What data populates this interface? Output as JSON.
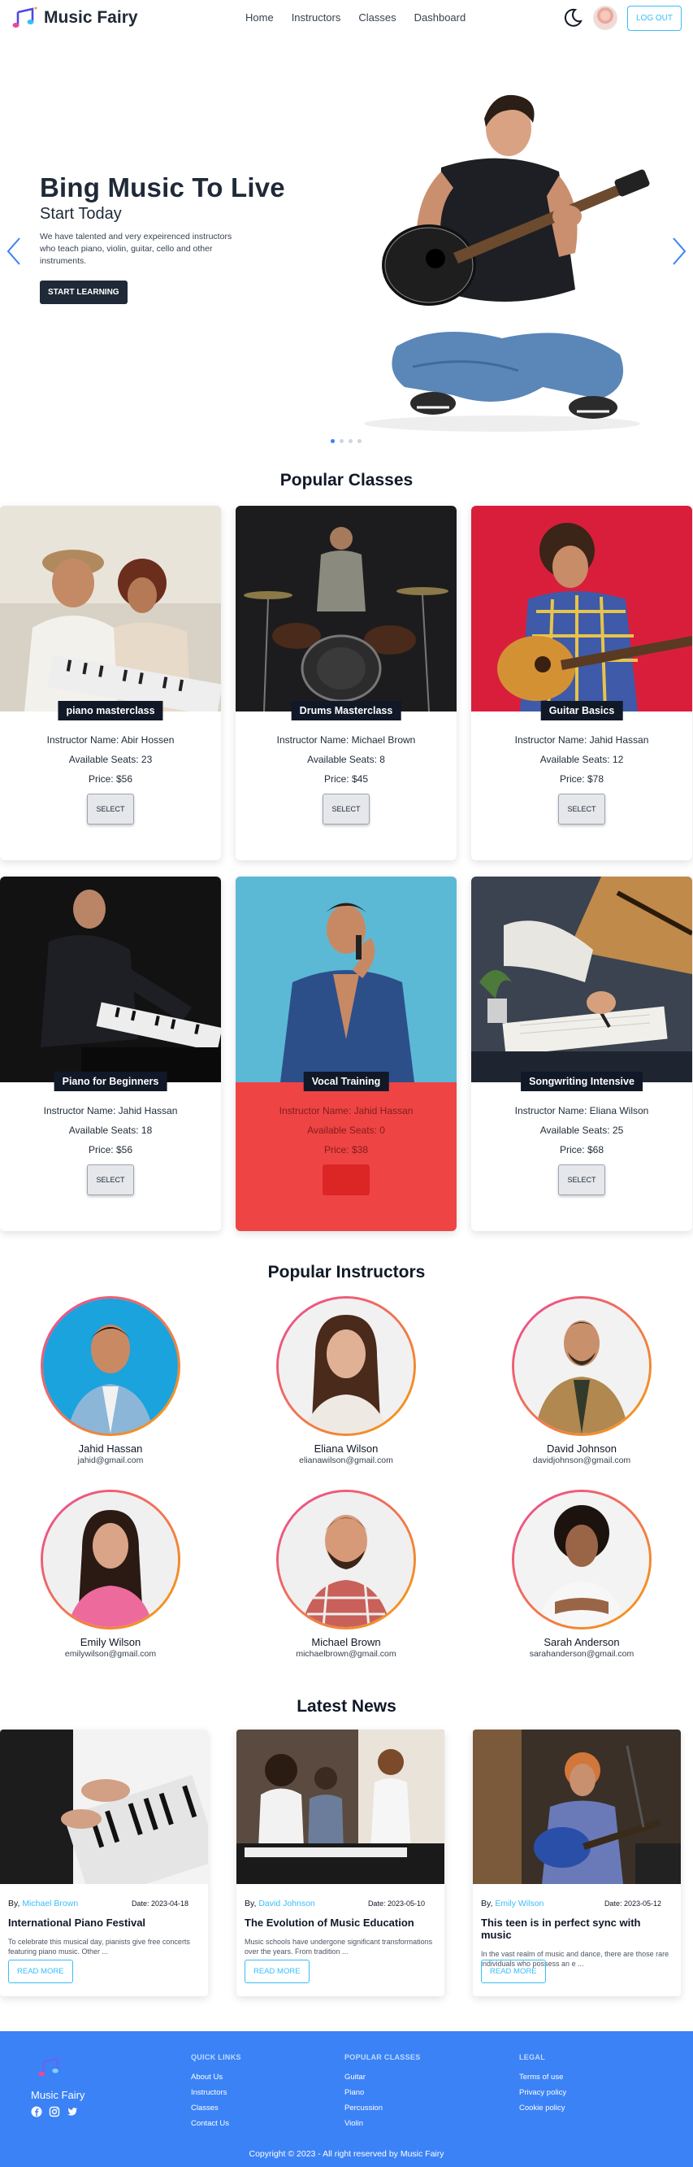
{
  "navbar": {
    "brand": "Music Fairy",
    "links": [
      "Home",
      "Instructors",
      "Classes",
      "Dashboard"
    ],
    "logout": "LOG OUT"
  },
  "hero": {
    "title": "Bing Music To Live",
    "subtitle": "Start Today",
    "description": "We have talented and very expeirenced instructors who teach piano, violin, guitar, cello and other instruments.",
    "button": "START LEARNING",
    "slide_count": 4,
    "active_slide": 1
  },
  "classes": {
    "title": "Popular Classes",
    "instructor_prefix": "Instructor Name: ",
    "seats_prefix": "Available Seats: ",
    "price_prefix": "Price: $",
    "select_label": "SELECT",
    "items": [
      {
        "name": "piano masterclass",
        "instructor": "Abir Hossen",
        "seats": "23",
        "price": "56",
        "sold_out": false
      },
      {
        "name": "Drums Masterclass",
        "instructor": "Michael Brown",
        "seats": "8",
        "price": "45",
        "sold_out": false
      },
      {
        "name": "Guitar Basics",
        "instructor": "Jahid Hassan",
        "seats": "12",
        "price": "78",
        "sold_out": false
      },
      {
        "name": "Piano for Beginners",
        "instructor": "Jahid Hassan",
        "seats": "18",
        "price": "56",
        "sold_out": false
      },
      {
        "name": "Vocal Training",
        "instructor": "Jahid Hassan",
        "seats": "0",
        "price": "38",
        "sold_out": true
      },
      {
        "name": "Songwriting Intensive",
        "instructor": "Eliana Wilson",
        "seats": "25",
        "price": "68",
        "sold_out": false
      }
    ]
  },
  "instructors": {
    "title": "Popular Instructors",
    "items": [
      {
        "name": "Jahid Hassan",
        "email": "jahid@gmail.com"
      },
      {
        "name": "Eliana Wilson",
        "email": "elianawilson@gmail.com"
      },
      {
        "name": "David Johnson",
        "email": "davidjohnson@gmail.com"
      },
      {
        "name": "Emily Wilson",
        "email": "emilywilson@gmail.com"
      },
      {
        "name": "Michael Brown",
        "email": "michaelbrown@gmail.com"
      },
      {
        "name": "Sarah Anderson",
        "email": "sarahanderson@gmail.com"
      }
    ]
  },
  "news": {
    "title": "Latest News",
    "by_label": "By, ",
    "date_label": "Date: ",
    "read_more": "READ MORE",
    "items": [
      {
        "author": "Michael Brown",
        "date": "2023-04-18",
        "headline": "International Piano Festival",
        "body": "To celebrate this musical day, pianists give free concerts featuring piano music. Other ..."
      },
      {
        "author": "David Johnson",
        "date": "2023-05-10",
        "headline": "The Evolution of Music Education",
        "body": "Music schools have undergone significant transformations over the years. From tradition ..."
      },
      {
        "author": "Emily Wilson",
        "date": "2023-05-12",
        "headline": "This teen is in perfect sync with music",
        "body": "In the vast realm of music and dance, there are those rare individuals who possess an e ..."
      }
    ]
  },
  "footer": {
    "brand": "Music Fairy",
    "quick_links": {
      "heading": "QUICK LINKS",
      "items": [
        "About Us",
        "Instructors",
        "Classes",
        "Contact Us"
      ]
    },
    "popular_classes": {
      "heading": "POPULAR CLASSES",
      "items": [
        "Guitar",
        "Piano",
        "Percussion",
        "Violin"
      ]
    },
    "legal": {
      "heading": "LEGAL",
      "items": [
        "Terms of use",
        "Privacy policy",
        "Cookie policy"
      ]
    },
    "copyright": "Copyright © 2023 - All right reserved by Music Fairy"
  },
  "colors": {
    "accent": "#3b82f6",
    "outline": "#38bdf8",
    "sold_out": "#ef4444",
    "dark": "#1f2937"
  }
}
